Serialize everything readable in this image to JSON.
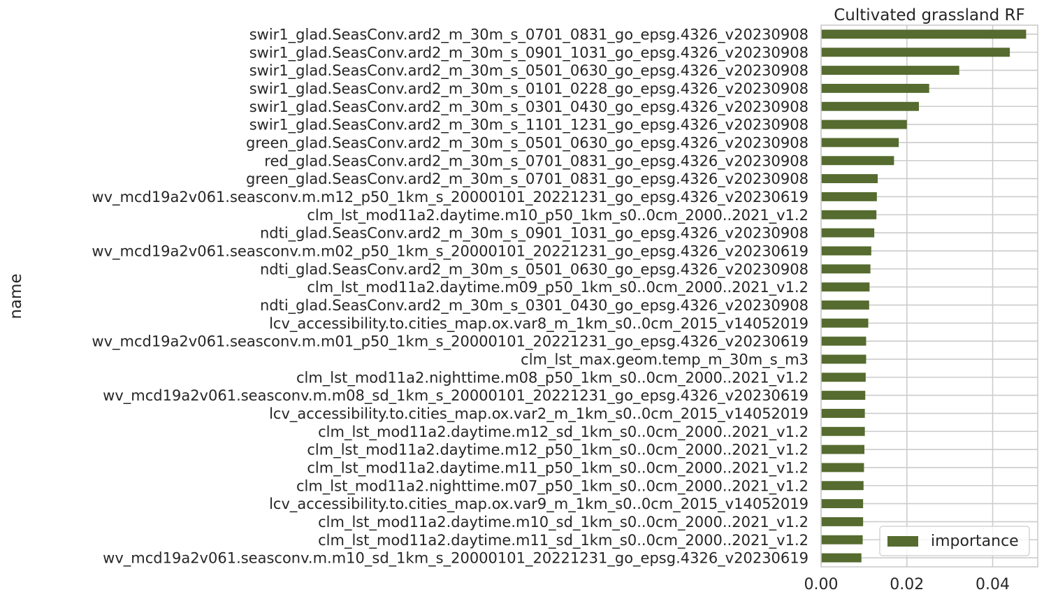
{
  "chart_data": {
    "type": "bar",
    "orientation": "horizontal",
    "title": "Cultivated grassland RF",
    "xlabel": "",
    "ylabel": "name",
    "xlim": [
      0,
      0.0505
    ],
    "xticks": [
      0.0,
      0.02,
      0.04
    ],
    "xtick_labels": [
      "0.00",
      "0.02",
      "0.04"
    ],
    "grid": true,
    "legend_position": "bottom-right",
    "categories": [
      "swir1_glad.SeasConv.ard2_m_30m_s_0701_0831_go_epsg.4326_v20230908",
      "swir1_glad.SeasConv.ard2_m_30m_s_0901_1031_go_epsg.4326_v20230908",
      "swir1_glad.SeasConv.ard2_m_30m_s_0501_0630_go_epsg.4326_v20230908",
      "swir1_glad.SeasConv.ard2_m_30m_s_0101_0228_go_epsg.4326_v20230908",
      "swir1_glad.SeasConv.ard2_m_30m_s_0301_0430_go_epsg.4326_v20230908",
      "swir1_glad.SeasConv.ard2_m_30m_s_1101_1231_go_epsg.4326_v20230908",
      "green_glad.SeasConv.ard2_m_30m_s_0501_0630_go_epsg.4326_v20230908",
      "red_glad.SeasConv.ard2_m_30m_s_0701_0831_go_epsg.4326_v20230908",
      "green_glad.SeasConv.ard2_m_30m_s_0701_0831_go_epsg.4326_v20230908",
      "wv_mcd19a2v061.seasconv.m.m12_p50_1km_s_20000101_20221231_go_epsg.4326_v20230619",
      "clm_lst_mod11a2.daytime.m10_p50_1km_s0..0cm_2000..2021_v1.2",
      "ndti_glad.SeasConv.ard2_m_30m_s_0901_1031_go_epsg.4326_v20230908",
      "wv_mcd19a2v061.seasconv.m.m02_p50_1km_s_20000101_20221231_go_epsg.4326_v20230619",
      "ndti_glad.SeasConv.ard2_m_30m_s_0501_0630_go_epsg.4326_v20230908",
      "clm_lst_mod11a2.daytime.m09_p50_1km_s0..0cm_2000..2021_v1.2",
      "ndti_glad.SeasConv.ard2_m_30m_s_0301_0430_go_epsg.4326_v20230908",
      "lcv_accessibility.to.cities_map.ox.var8_m_1km_s0..0cm_2015_v14052019",
      "wv_mcd19a2v061.seasconv.m.m01_p50_1km_s_20000101_20221231_go_epsg.4326_v20230619",
      "clm_lst_max.geom.temp_m_30m_s_m3",
      "clm_lst_mod11a2.nighttime.m08_p50_1km_s0..0cm_2000..2021_v1.2",
      "wv_mcd19a2v061.seasconv.m.m08_sd_1km_s_20000101_20221231_go_epsg.4326_v20230619",
      "lcv_accessibility.to.cities_map.ox.var2_m_1km_s0..0cm_2015_v14052019",
      "clm_lst_mod11a2.daytime.m12_sd_1km_s0..0cm_2000..2021_v1.2",
      "clm_lst_mod11a2.daytime.m12_p50_1km_s0..0cm_2000..2021_v1.2",
      "clm_lst_mod11a2.daytime.m11_p50_1km_s0..0cm_2000..2021_v1.2",
      "clm_lst_mod11a2.nighttime.m07_p50_1km_s0..0cm_2000..2021_v1.2",
      "lcv_accessibility.to.cities_map.ox.var9_m_1km_s0..0cm_2015_v14052019",
      "clm_lst_mod11a2.daytime.m10_sd_1km_s0..0cm_2000..2021_v1.2",
      "clm_lst_mod11a2.daytime.m11_sd_1km_s0..0cm_2000..2021_v1.2",
      "wv_mcd19a2v061.seasconv.m.m10_sd_1km_s_20000101_20221231_go_epsg.4326_v20230619"
    ],
    "series": [
      {
        "name": "importance",
        "color": "#556b2f",
        "values": [
          0.0478,
          0.044,
          0.0322,
          0.0252,
          0.0228,
          0.02,
          0.0181,
          0.017,
          0.0132,
          0.013,
          0.0129,
          0.0124,
          0.0117,
          0.0115,
          0.0113,
          0.0112,
          0.011,
          0.0105,
          0.0105,
          0.0104,
          0.0103,
          0.0102,
          0.0102,
          0.0101,
          0.01,
          0.0099,
          0.0098,
          0.0098,
          0.0097,
          0.0094
        ]
      }
    ]
  }
}
